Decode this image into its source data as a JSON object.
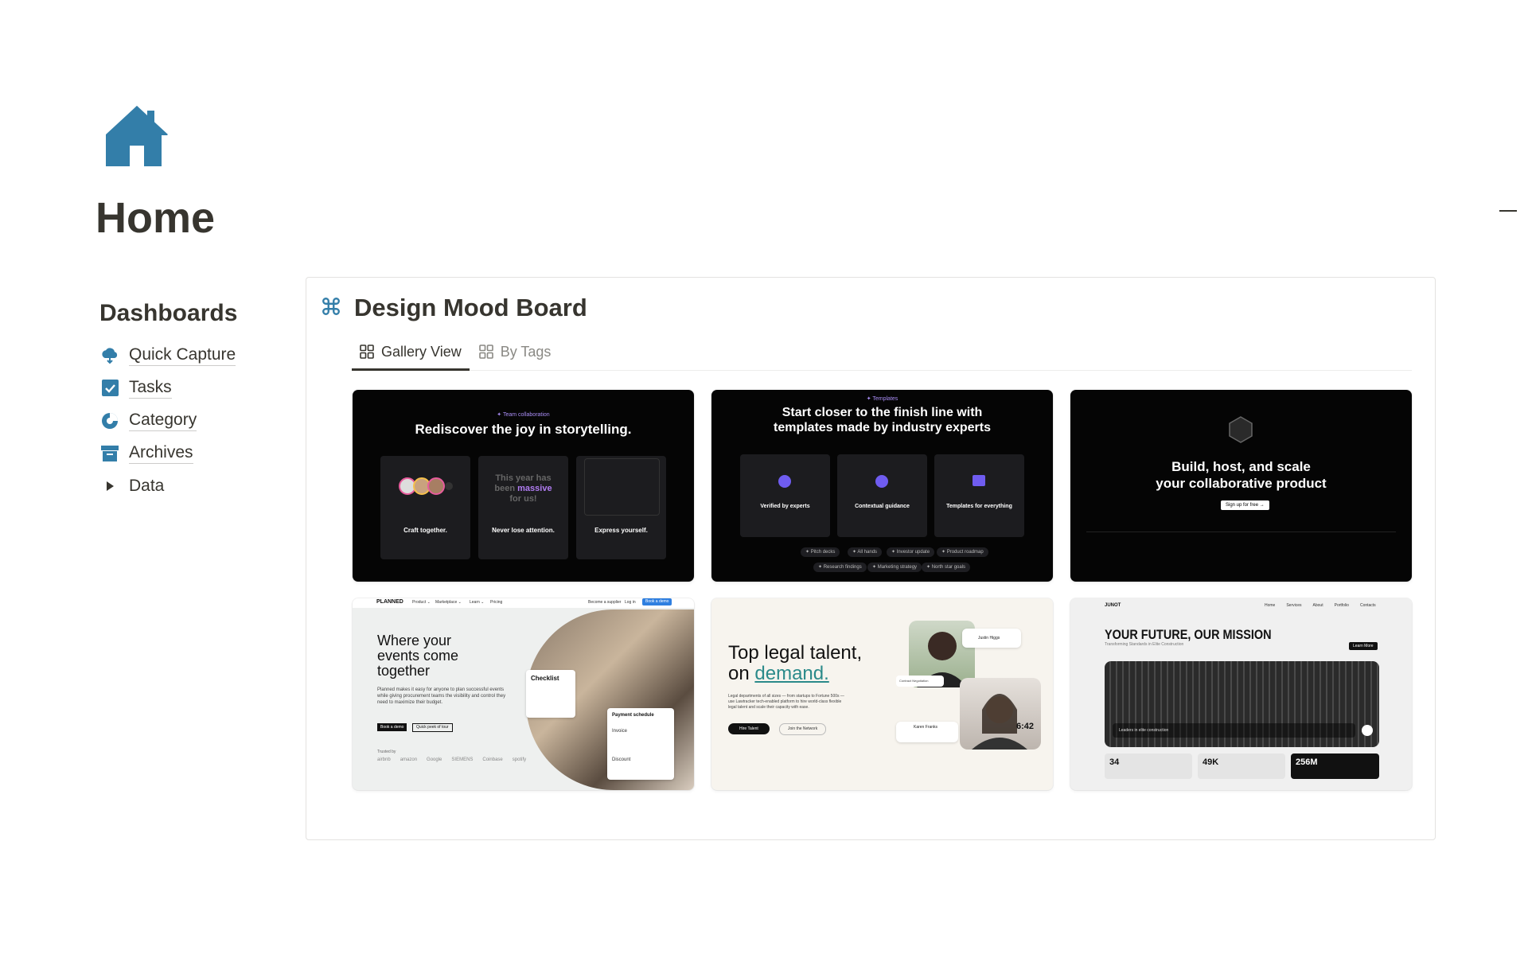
{
  "page": {
    "title": "Home",
    "icon": "home-icon"
  },
  "sidebar": {
    "heading": "Dashboards",
    "items": [
      {
        "label": "Quick Capture",
        "icon": "cloud-capture-icon"
      },
      {
        "label": "Tasks",
        "icon": "checkbox-icon"
      },
      {
        "label": "Category",
        "icon": "pie-chart-icon"
      },
      {
        "label": "Archives",
        "icon": "archive-box-icon"
      },
      {
        "label": "Data",
        "icon": "triangle-right-icon"
      }
    ]
  },
  "board": {
    "icon": "command-icon",
    "title": "Design Mood Board",
    "tabs": [
      {
        "label": "Gallery View",
        "active": true,
        "icon": "gallery-grid-icon"
      },
      {
        "label": "By Tags",
        "active": false,
        "icon": "gallery-grid-icon"
      }
    ]
  },
  "cards": {
    "c1": {
      "eyebrow": "✦ Team collaboration",
      "headline": "Rediscover the joy in storytelling.",
      "panels": [
        "Craft together.",
        "Never lose attention.",
        "Express yourself."
      ],
      "middle_text_a": "This year has",
      "middle_text_b": "been",
      "middle_text_highlight": "massive",
      "middle_text_c": "for us!"
    },
    "c2": {
      "eyebrow": "✦ Templates",
      "headline_1": "Start closer to the finish line with",
      "headline_2": "templates made by industry experts",
      "panels": [
        "Verified by experts",
        "Contextual guidance",
        "Templates for everything"
      ],
      "tags_row1": [
        "✦ Pitch decks",
        "✦ All hands",
        "✦ Investor update",
        "✦ Product roadmap"
      ],
      "tags_row2": [
        "✦ Research findings",
        "✦ Marketing strategy",
        "✦ North star goals"
      ]
    },
    "c3": {
      "headline_1": "Build, host, and scale",
      "headline_2": "your collaborative product",
      "cta": "Sign up for free  →"
    },
    "c4": {
      "brand": "PLANNED",
      "nav": [
        "Product ⌄",
        "Marketplace ⌄",
        "Learn ⌄",
        "Pricing"
      ],
      "nav_right": [
        "Become a supplier",
        "Log in"
      ],
      "nav_cta": "Book a demo",
      "headline_1": "Where your",
      "headline_2": "events come",
      "headline_3": "together",
      "body": "Planned makes it easy for anyone to plan successful events while giving procurement teams the visibility and control they need to maximize their budget.",
      "btn_primary": "Book a demo",
      "btn_secondary": "Quick peek of tour",
      "trusted": "Trusted by",
      "logos": [
        "airbnb",
        "amazon",
        "Google",
        "SIEMENS",
        "Coinbase",
        "spotify"
      ],
      "checklist": "Checklist",
      "payment": "Payment schedule",
      "invoice": "Invoice",
      "discount": "Discount"
    },
    "c5": {
      "headline_1": "Top legal talent,",
      "headline_2": "on",
      "headline_accent": "demand.",
      "body": "Legal departments of all sizes — from startups to Fortune 500s — use Lawtracker tech-enabled platform to hire world-class flexible legal talent and scale their capacity with ease.",
      "btn_primary": "Hire Talent",
      "btn_secondary": "Join the Network",
      "chip_name": "Justin Higgs",
      "chip_name_2": "Karen Franks",
      "time": "6:42",
      "chip_role": "Contract Negotiation"
    },
    "c6": {
      "brand": "JUNOT",
      "nav": [
        "Home",
        "Services",
        "About",
        "Portfolio",
        "Contacts"
      ],
      "headline": "YOUR FUTURE, OUR MISSION",
      "sub": "Transforming Standards in Elite Construction",
      "cta": "Learn More",
      "caption": "Leaders in elite construction",
      "stats": [
        "34",
        "49K",
        "256M"
      ]
    }
  },
  "colors": {
    "accent_blue": "#337ea9",
    "text": "#37352f",
    "muted": "#8a8984",
    "purple": "#b07cf2",
    "teal": "#2b8a8a"
  }
}
